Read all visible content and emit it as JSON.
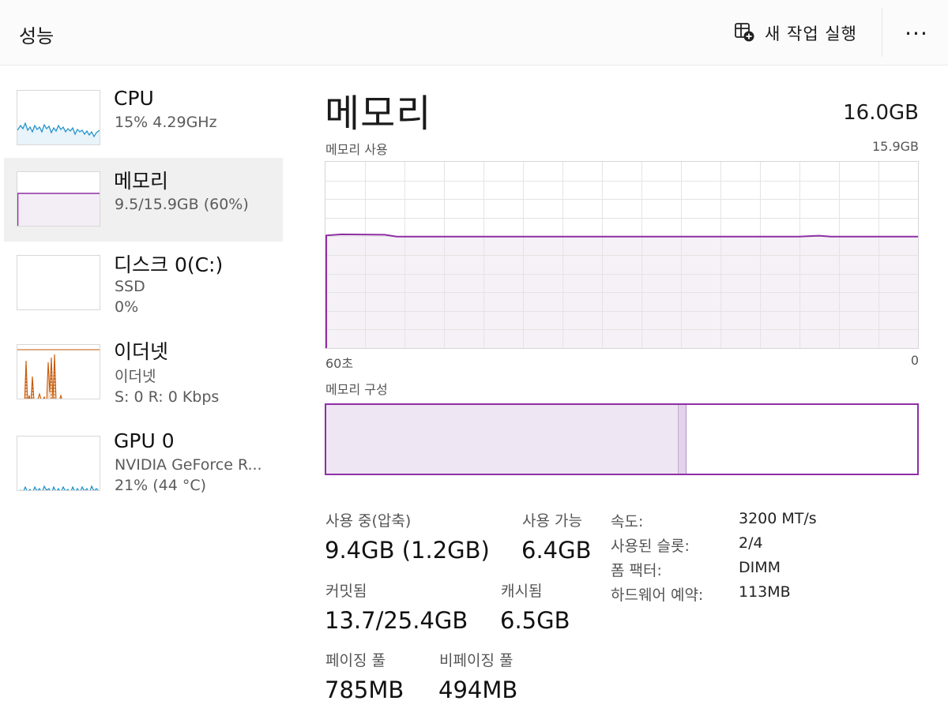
{
  "header": {
    "title": "성능",
    "run_task_label": "새 작업 실행",
    "more_label": "···"
  },
  "sidebar": {
    "items": [
      {
        "name": "CPU",
        "line1": "15% 4.29GHz",
        "line2": ""
      },
      {
        "name": "메모리",
        "line1": "9.5/15.9GB (60%)",
        "line2": ""
      },
      {
        "name": "디스크 0(C:)",
        "line1": "SSD",
        "line2": "0%"
      },
      {
        "name": "이더넷",
        "line1": "이더넷",
        "line2": "S: 0 R: 0 Kbps"
      },
      {
        "name": "GPU 0",
        "line1": "NVIDIA GeForce R...",
        "line2": "21% (44 °C)"
      }
    ]
  },
  "main": {
    "title": "메모리",
    "total": "16.0GB",
    "usage_chart": {
      "label": "메모리 사용",
      "max_label": "15.9GB",
      "left_label": "60초",
      "right_label": "0",
      "fill_fraction": 0.6,
      "line_color": "#8f2fa5",
      "fill_color": "#f3eef5"
    },
    "composition": {
      "label": "메모리 구성",
      "in_use_fraction": 0.595,
      "modified_fraction": 0.012
    },
    "stats": {
      "in_use_label": "사용 중(압축)",
      "in_use_value": "9.4GB (1.2GB)",
      "available_label": "사용 가능",
      "available_value": "6.4GB",
      "committed_label": "커밋됨",
      "committed_value": "13.7/25.4GB",
      "cached_label": "캐시됨",
      "cached_value": "6.5GB",
      "paged_label": "페이징 풀",
      "paged_value": "785MB",
      "nonpaged_label": "비페이징 풀",
      "nonpaged_value": "494MB"
    },
    "details": [
      {
        "key": "속도:",
        "value": "3200 MT/s"
      },
      {
        "key": "사용된 슬롯:",
        "value": "2/4"
      },
      {
        "key": "폼 팩터:",
        "value": "DIMM"
      },
      {
        "key": "하드웨어 예약:",
        "value": "113MB"
      }
    ]
  },
  "colors": {
    "cpu": "#1b8fc7",
    "memory": "#8f2fa5",
    "ethernet": "#c65a0a",
    "gpu": "#1b8fc7"
  }
}
